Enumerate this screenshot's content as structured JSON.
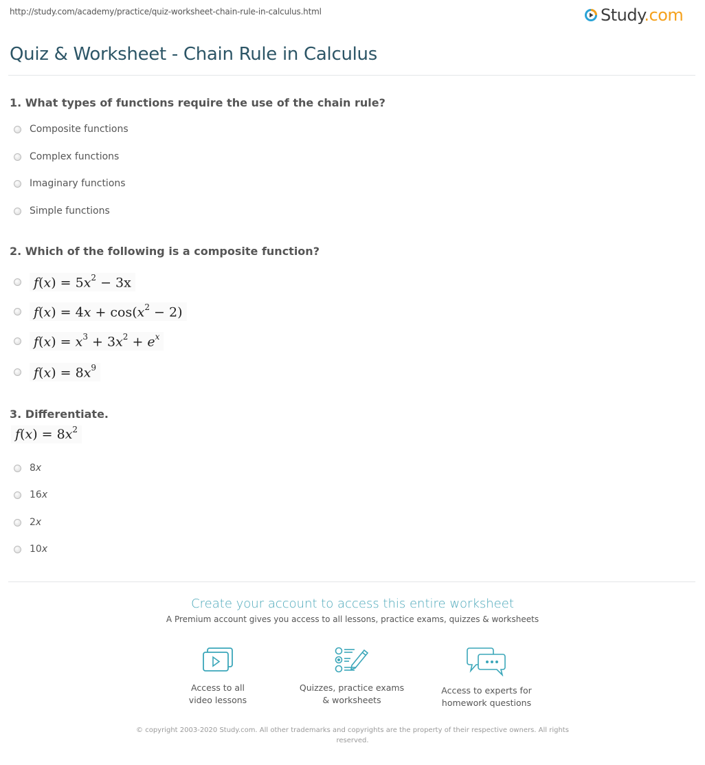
{
  "browser": {
    "url": "http://study.com/academy/practice/quiz-worksheet-chain-rule-in-calculus.html"
  },
  "brand": {
    "logo_name": "Study",
    "logo_suffix": ".com",
    "logo_icon": "play-circle-icon",
    "colors": {
      "blue": "#2aa3d6",
      "orange": "#f5a11c",
      "title": "#2c5566",
      "accent": "#4aa7b9"
    }
  },
  "page": {
    "title": "Quiz & Worksheet - Chain Rule in Calculus"
  },
  "questions": [
    {
      "title": "1. What types of functions require the use of the chain rule?",
      "options": [
        "Composite functions",
        "Complex functions",
        "Imaginary functions",
        "Simple functions"
      ]
    },
    {
      "title": "2. Which of the following is a composite function?",
      "options": [
        "f(x) = 5x^2 − 3x",
        "f(x) = 4x + cos(x^2 − 2)",
        "f(x) = x^3 + 3x^2 + e^x",
        "f(x) = 8x^9"
      ]
    },
    {
      "title": "3. Differentiate.",
      "prompt": "f(x) = 8x^2",
      "options": [
        "8x",
        "16x",
        "2x",
        "10x"
      ]
    }
  ],
  "cta": {
    "title": "Create your account to access this entire worksheet",
    "subtitle": "A Premium account gives you access to all lessons, practice exams, quizzes & worksheets",
    "features": [
      {
        "icon": "video-lessons-icon",
        "line1": "Access to all",
        "line2": "video lessons"
      },
      {
        "icon": "quiz-checklist-icon",
        "line1": "Quizzes, practice exams",
        "line2": "& worksheets"
      },
      {
        "icon": "chat-bubbles-icon",
        "line1": "Access to experts for",
        "line2": "homework questions"
      }
    ]
  },
  "footer": {
    "copyright": "© copyright 2003-2020 Study.com. All other trademarks and copyrights are the property of their respective owners. All rights reserved."
  }
}
